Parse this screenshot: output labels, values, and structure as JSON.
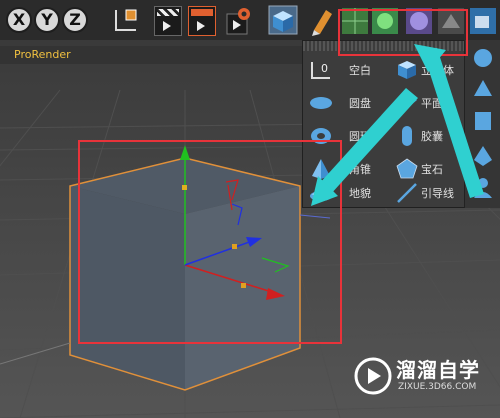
{
  "toolbar": {
    "axis_x": "X",
    "axis_y": "Y",
    "axis_z": "Z"
  },
  "renderer": {
    "label": "ProRender"
  },
  "popup": {
    "items": [
      {
        "label": "空白",
        "icon": "null-object-icon"
      },
      {
        "label": "立方体",
        "icon": "cube-icon"
      },
      {
        "label": "圆盘",
        "icon": "disc-icon"
      },
      {
        "label": "平面",
        "icon": "plane-icon"
      },
      {
        "label": "圆环",
        "icon": "torus-icon"
      },
      {
        "label": "胶囊",
        "icon": "capsule-icon"
      },
      {
        "label": "角锥",
        "icon": "pyramid-icon"
      },
      {
        "label": "宝石",
        "icon": "gem-icon"
      },
      {
        "label": "地貌",
        "icon": "landscape-icon"
      },
      {
        "label": "引导线",
        "icon": "guide-line-icon"
      }
    ]
  },
  "watermark": {
    "title": "溜溜自学",
    "url": "ZIXUE.3D66.COM"
  },
  "colors": {
    "annotation_red": "#e8333a",
    "annotation_cyan": "#2fd0d0",
    "axis_x": "#d02020",
    "axis_y": "#20c020",
    "axis_z": "#2030e0"
  }
}
